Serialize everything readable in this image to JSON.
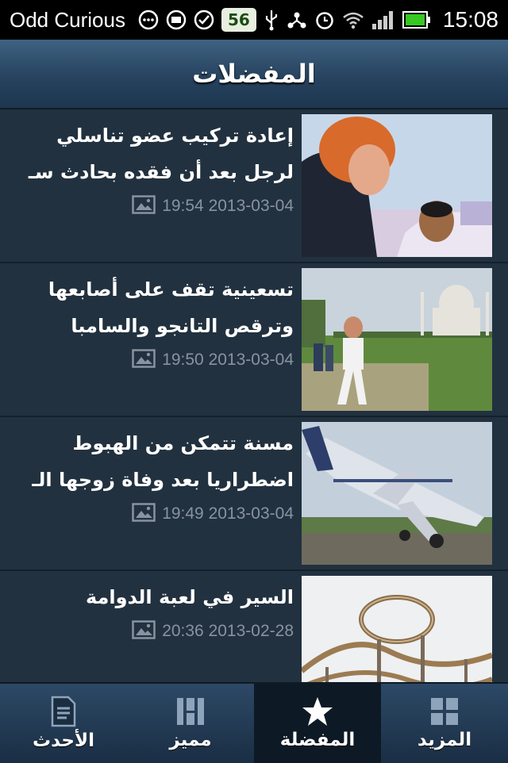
{
  "status_bar": {
    "carrier": "Odd Curious",
    "badge": "56",
    "time": "15:08",
    "icons": [
      "more-icon",
      "m-icon",
      "check-icon",
      "badge-icon",
      "usb-icon",
      "share-icon",
      "alarm-icon",
      "wifi-icon",
      "signal-icon",
      "battery-icon"
    ]
  },
  "header": {
    "title": "المفضلات"
  },
  "articles": [
    {
      "headline": "إعادة تركيب عضو تناسلي لرجل بعد أن فقده بحادث سـ",
      "datetime": "19:54 2013-03-04",
      "thumb": "photo-woman-man"
    },
    {
      "headline": "تسعينية تقف على أصابعها وترقص التانجو والسامبا",
      "datetime": "19:50 2013-03-04",
      "thumb": "photo-taj-mahal"
    },
    {
      "headline": "مسنة تتمكن من الهبوط اضطراريا بعد وفاة زوجها الـ",
      "datetime": "19:49 2013-03-04",
      "thumb": "photo-plane"
    },
    {
      "headline": "السير في لعبة الدوامة",
      "datetime": "20:36 2013-02-28",
      "thumb": "photo-rollercoaster"
    }
  ],
  "tabs": [
    {
      "label": "الأحدث",
      "icon": "document-icon",
      "active": false
    },
    {
      "label": "مميز",
      "icon": "columns-icon",
      "active": false
    },
    {
      "label": "المفضلة",
      "icon": "star-icon",
      "active": true
    },
    {
      "label": "المزيد",
      "icon": "grid-icon",
      "active": false
    }
  ],
  "colors": {
    "background": "#22313f",
    "header": "#27435f",
    "meta_text": "#8893a0",
    "active_tab": "#0d1a26"
  }
}
